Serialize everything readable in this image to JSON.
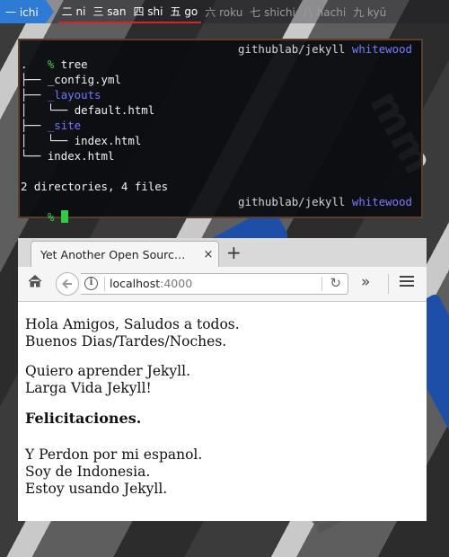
{
  "workspaces": [
    {
      "label": "一 ichi",
      "state": "active"
    },
    {
      "label": "二 ni",
      "state": "occupied"
    },
    {
      "label": "三 san",
      "state": "occupied"
    },
    {
      "label": "四 shi",
      "state": "occupied"
    },
    {
      "label": "五 go",
      "state": "occupied"
    },
    {
      "label": "六 roku",
      "state": "empty"
    },
    {
      "label": "七 shichi",
      "state": "empty"
    },
    {
      "label": "八 hachi",
      "state": "empty"
    },
    {
      "label": "九 kyū",
      "state": "empty"
    }
  ],
  "terminal": {
    "prompt_symbol": "%",
    "command": "tree",
    "path": "githublab/jekyll",
    "branch": "whitewood",
    "tree_lines": [
      {
        "text": ".",
        "type": "file"
      },
      {
        "text": "├── _config.yml",
        "type": "file"
      },
      {
        "text": "├── _layouts",
        "type": "dir"
      },
      {
        "text": "│   └── default.html",
        "type": "file"
      },
      {
        "text": "├── _site",
        "type": "dir"
      },
      {
        "text": "│   └── index.html",
        "type": "file"
      },
      {
        "text": "└── index.html",
        "type": "file"
      }
    ],
    "summary": "2 directories, 4 files"
  },
  "browser": {
    "tab_title": "Yet Another Open Sourc…",
    "tab_close": "×",
    "new_tab": "+",
    "url_host": "localhost",
    "url_port": ":4000",
    "paragraphs": [
      [
        "Hola Amigos, Saludos a todos.",
        "Buenos Dias/Tardes/Noches."
      ],
      [
        "Quiero aprender Jekyll.",
        "Larga Vida Jekyll!"
      ]
    ],
    "heading": "Felicitaciones.",
    "closing": [
      "Y Perdon por mi espanol.",
      "Soy de Indonesia.",
      "Estoy usando Jekyll."
    ]
  },
  "colors": {
    "workspace_active": "#2e7bd6",
    "workspace_underline": "#d3242e",
    "prompt": "#38d84a",
    "branch": "#7b7bff",
    "terminal_border": "#5a3d2a"
  }
}
